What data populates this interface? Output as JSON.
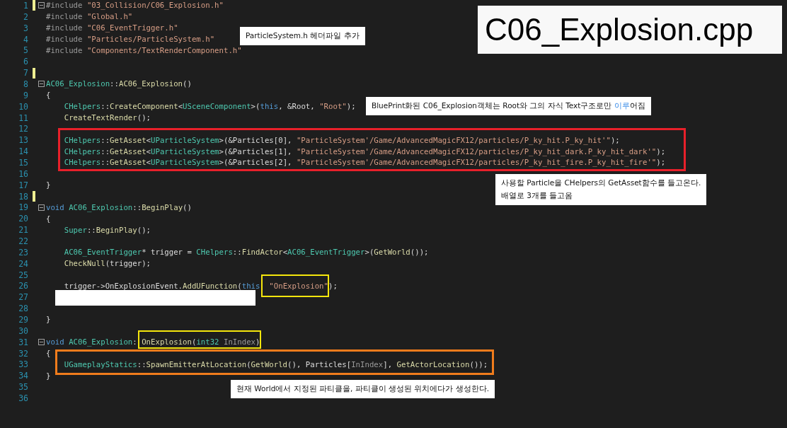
{
  "title": "C06_Explosion.cpp",
  "lines": [
    {
      "number": "1",
      "modified": true,
      "fold_marker": true,
      "code": [
        {
          "text": "#include ",
          "kind": "pp"
        },
        {
          "text": "\"03_Collision/C06_Explosion.h\"",
          "kind": "str"
        }
      ]
    },
    {
      "number": "2",
      "modified": false,
      "fold_marker": false,
      "code": [
        {
          "text": "#include ",
          "kind": "pp"
        },
        {
          "text": "\"Global.h\"",
          "kind": "str"
        }
      ]
    },
    {
      "number": "3",
      "modified": false,
      "fold_marker": false,
      "code": [
        {
          "text": "#include ",
          "kind": "pp"
        },
        {
          "text": "\"C06_EventTrigger.h\"",
          "kind": "str"
        }
      ]
    },
    {
      "number": "4",
      "modified": false,
      "fold_marker": false,
      "code": [
        {
          "text": "#include ",
          "kind": "pp"
        },
        {
          "text": "\"Particles/ParticleSystem.h\"",
          "kind": "str"
        }
      ]
    },
    {
      "number": "5",
      "modified": false,
      "fold_marker": false,
      "code": [
        {
          "text": "#include ",
          "kind": "pp"
        },
        {
          "text": "\"Components/TextRenderComponent.h\"",
          "kind": "str"
        }
      ]
    },
    {
      "number": "6",
      "modified": false,
      "fold_marker": false
    },
    {
      "number": "7",
      "modified": true,
      "fold_marker": false
    },
    {
      "number": "8",
      "modified": false,
      "fold_marker": true,
      "code": [
        {
          "text": "AC06_Explosion",
          "kind": "type"
        },
        {
          "text": "::",
          "kind": "plain"
        },
        {
          "text": "AC06_Explosion",
          "kind": "fn"
        },
        {
          "text": "()",
          "kind": "plain"
        }
      ]
    },
    {
      "number": "9",
      "modified": false,
      "fold_marker": false,
      "code": [
        {
          "text": "{",
          "kind": "plain"
        }
      ]
    },
    {
      "number": "10",
      "modified": false,
      "fold_marker": false,
      "code": [
        {
          "text": "    CHelpers",
          "kind": "type"
        },
        {
          "text": "::",
          "kind": "plain"
        },
        {
          "text": "CreateComponent",
          "kind": "fn"
        },
        {
          "text": "<",
          "kind": "plain"
        },
        {
          "text": "USceneComponent",
          "kind": "type"
        },
        {
          "text": ">(",
          "kind": "plain"
        },
        {
          "text": "this",
          "kind": "kw"
        },
        {
          "text": ", &Root, ",
          "kind": "plain"
        },
        {
          "text": "\"Root\"",
          "kind": "str"
        },
        {
          "text": ");",
          "kind": "plain"
        }
      ]
    },
    {
      "number": "11",
      "modified": false,
      "fold_marker": false,
      "code": [
        {
          "text": "    CreateTextRender",
          "kind": "fn"
        },
        {
          "text": "();",
          "kind": "plain"
        }
      ]
    },
    {
      "number": "12",
      "modified": false,
      "fold_marker": false
    },
    {
      "number": "13",
      "modified": false,
      "fold_marker": false,
      "code": [
        {
          "text": "    CHelpers",
          "kind": "type"
        },
        {
          "text": "::",
          "kind": "plain"
        },
        {
          "text": "GetAsset",
          "kind": "fn"
        },
        {
          "text": "<",
          "kind": "plain"
        },
        {
          "text": "UParticleSystem",
          "kind": "type"
        },
        {
          "text": ">(&Particles[0], ",
          "kind": "plain"
        },
        {
          "text": "\"ParticleSystem'/Game/AdvancedMagicFX12/particles/P_ky_hit.P_ky_hit'\"",
          "kind": "str"
        },
        {
          "text": ");",
          "kind": "plain"
        }
      ]
    },
    {
      "number": "14",
      "modified": false,
      "fold_marker": false,
      "code": [
        {
          "text": "    CHelpers",
          "kind": "type"
        },
        {
          "text": "::",
          "kind": "plain"
        },
        {
          "text": "GetAsset",
          "kind": "fn"
        },
        {
          "text": "<",
          "kind": "plain"
        },
        {
          "text": "UParticleSystem",
          "kind": "type"
        },
        {
          "text": ">(&Particles[1], ",
          "kind": "plain"
        },
        {
          "text": "\"ParticleSystem'/Game/AdvancedMagicFX12/particles/P_ky_hit_dark.P_ky_hit_dark'\"",
          "kind": "str"
        },
        {
          "text": ");",
          "kind": "plain"
        }
      ]
    },
    {
      "number": "15",
      "modified": false,
      "fold_marker": false,
      "code": [
        {
          "text": "    CHelpers",
          "kind": "type"
        },
        {
          "text": "::",
          "kind": "plain"
        },
        {
          "text": "GetAsset",
          "kind": "fn"
        },
        {
          "text": "<",
          "kind": "plain"
        },
        {
          "text": "UParticleSystem",
          "kind": "type"
        },
        {
          "text": ">(&Particles[2], ",
          "kind": "plain"
        },
        {
          "text": "\"ParticleSystem'/Game/AdvancedMagicFX12/particles/P_ky_hit_fire.P_ky_hit_fire'\"",
          "kind": "str"
        },
        {
          "text": ");",
          "kind": "plain"
        }
      ]
    },
    {
      "number": "16",
      "modified": false,
      "fold_marker": false
    },
    {
      "number": "17",
      "modified": false,
      "fold_marker": false,
      "code": [
        {
          "text": "}",
          "kind": "plain"
        }
      ]
    },
    {
      "number": "18",
      "modified": true,
      "fold_marker": false
    },
    {
      "number": "19",
      "modified": false,
      "fold_marker": true,
      "code": [
        {
          "text": "void ",
          "kind": "kw"
        },
        {
          "text": "AC06_Explosion",
          "kind": "type"
        },
        {
          "text": "::",
          "kind": "plain"
        },
        {
          "text": "BeginPlay",
          "kind": "fn"
        },
        {
          "text": "()",
          "kind": "plain"
        }
      ]
    },
    {
      "number": "20",
      "modified": false,
      "fold_marker": false,
      "code": [
        {
          "text": "{",
          "kind": "plain"
        }
      ]
    },
    {
      "number": "21",
      "modified": false,
      "fold_marker": false,
      "code": [
        {
          "text": "    Super",
          "kind": "type"
        },
        {
          "text": "::",
          "kind": "plain"
        },
        {
          "text": "BeginPlay",
          "kind": "fn"
        },
        {
          "text": "();",
          "kind": "plain"
        }
      ]
    },
    {
      "number": "22",
      "modified": false,
      "fold_marker": false
    },
    {
      "number": "23",
      "modified": false,
      "fold_marker": false,
      "code": [
        {
          "text": "    AC06_EventTrigger",
          "kind": "type"
        },
        {
          "text": "* trigger = ",
          "kind": "plain"
        },
        {
          "text": "CHelpers",
          "kind": "type"
        },
        {
          "text": "::",
          "kind": "plain"
        },
        {
          "text": "FindActor",
          "kind": "fn"
        },
        {
          "text": "<",
          "kind": "plain"
        },
        {
          "text": "AC06_EventTrigger",
          "kind": "type"
        },
        {
          "text": ">(",
          "kind": "plain"
        },
        {
          "text": "GetWorld",
          "kind": "fn"
        },
        {
          "text": "());",
          "kind": "plain"
        }
      ]
    },
    {
      "number": "24",
      "modified": false,
      "fold_marker": false,
      "code": [
        {
          "text": "    CheckNull",
          "kind": "fn"
        },
        {
          "text": "(trigger);",
          "kind": "plain"
        }
      ]
    },
    {
      "number": "25",
      "modified": false,
      "fold_marker": false
    },
    {
      "number": "26",
      "modified": false,
      "fold_marker": false,
      "code": [
        {
          "text": "    trigger->OnExplosionEvent.",
          "kind": "plain"
        },
        {
          "text": "AddUFunction",
          "kind": "fn"
        },
        {
          "text": "(",
          "kind": "plain"
        },
        {
          "text": "this",
          "kind": "kw"
        },
        {
          "text": "  \"OnExplosion\"",
          "kind": "str"
        },
        {
          "text": ");",
          "kind": "plain"
        }
      ]
    },
    {
      "number": "27",
      "modified": false,
      "fold_marker": false
    },
    {
      "number": "28",
      "modified": false,
      "fold_marker": false
    },
    {
      "number": "29",
      "modified": false,
      "fold_marker": false,
      "code": [
        {
          "text": "}",
          "kind": "plain"
        }
      ]
    },
    {
      "number": "30",
      "modified": false,
      "fold_marker": false
    },
    {
      "number": "31",
      "modified": false,
      "fold_marker": true,
      "code": [
        {
          "text": "void ",
          "kind": "kw"
        },
        {
          "text": "AC06_Explosion",
          "kind": "type"
        },
        {
          "text": ": ",
          "kind": "plain"
        },
        {
          "text": "OnExplosion",
          "kind": "fn"
        },
        {
          "text": "(",
          "kind": "plain"
        },
        {
          "text": "int32 ",
          "kind": "type"
        },
        {
          "text": "InIndex",
          "kind": "param"
        },
        {
          "text": ")",
          "kind": "plain"
        }
      ]
    },
    {
      "number": "32",
      "modified": false,
      "fold_marker": false,
      "code": [
        {
          "text": "{",
          "kind": "plain"
        }
      ]
    },
    {
      "number": "33",
      "modified": false,
      "fold_marker": false,
      "code": [
        {
          "text": "    UGameplayStatics",
          "kind": "type"
        },
        {
          "text": "::",
          "kind": "plain"
        },
        {
          "text": "SpawnEmitterAtLocation",
          "kind": "fn"
        },
        {
          "text": "(",
          "kind": "plain"
        },
        {
          "text": "GetWorld",
          "kind": "fn"
        },
        {
          "text": "(), Particles[",
          "kind": "plain"
        },
        {
          "text": "InIndex",
          "kind": "param"
        },
        {
          "text": "], ",
          "kind": "plain"
        },
        {
          "text": "GetActorLocation",
          "kind": "fn"
        },
        {
          "text": "());",
          "kind": "plain"
        }
      ]
    },
    {
      "number": "34",
      "modified": false,
      "fold_marker": false,
      "code": [
        {
          "text": "}",
          "kind": "plain"
        }
      ]
    },
    {
      "number": "35",
      "modified": false,
      "fold_marker": false
    },
    {
      "number": "36",
      "modified": false,
      "fold_marker": false
    }
  ],
  "highlights": [
    {
      "color": "#e8202a"
    },
    {
      "color": "#f5e60c"
    },
    {
      "color": "#f5e60c"
    },
    {
      "color": "#f07c1c"
    }
  ],
  "notes": [
    {
      "text": [
        {
          "text": "ParticleSystem.h 헤더파일 추가",
          "highlight": false
        }
      ]
    },
    {
      "text": [
        {
          "text": "BluePrint화된 C06_Explosion객체는 Root와 그의 자식 Text구조로만 ",
          "highlight": false
        },
        {
          "text": "이루",
          "highlight": true
        },
        {
          "text": "어짐",
          "highlight": false
        }
      ]
    },
    {
      "text": [
        {
          "text": "사용할 Particle을 CHelpers의 GetAsset함수를 들고온다.\n배열로 3개를 들고옴",
          "highlight": false
        }
      ]
    },
    {
      "text": [
        {
          "text": "현재 World에서 지정된 파티클을, 파티클이 생성된 위치에다가 생성한다.",
          "highlight": false
        }
      ]
    }
  ]
}
